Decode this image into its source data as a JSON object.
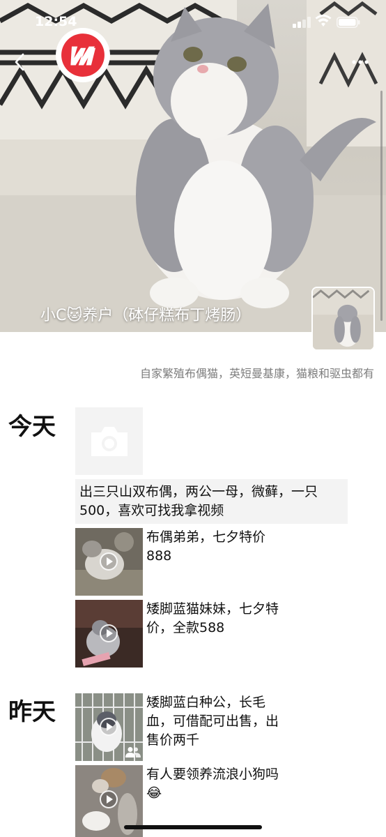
{
  "status_bar": {
    "time": "12:54"
  },
  "cover": {
    "title": "小C🐱养户（砵仔糕布丁烤肠）",
    "signature": "自家繁殖布偶猫，英短曼基康，猫粮和驱虫都有"
  },
  "icons": {
    "back": "chevron-left-icon",
    "logo": "brand-logo",
    "more": "more-dots-icon",
    "camera": "camera-icon",
    "play": "play-icon",
    "group": "group-icon"
  },
  "colors": {
    "logo_red": "#e8303a",
    "placeholder_bg": "#f3f3f3",
    "signature_text": "#7d7d7d"
  },
  "feed": {
    "today_label": "今天",
    "yesterday_label": "昨天",
    "text_post": "出三只山双布偶，两公一母，微藓，一只500，喜欢可找我拿视频",
    "posts": [
      {
        "caption": "布偶弟弟，七夕特价888",
        "type": "video"
      },
      {
        "caption": "矮脚蓝猫妹妹，七夕特价，全款588",
        "type": "video"
      },
      {
        "caption": "矮脚蓝白种公，长毛血，可借配可出售，出售价两千",
        "type": "video"
      },
      {
        "caption": "有人要领养流浪小狗吗😂",
        "type": "video"
      }
    ]
  }
}
